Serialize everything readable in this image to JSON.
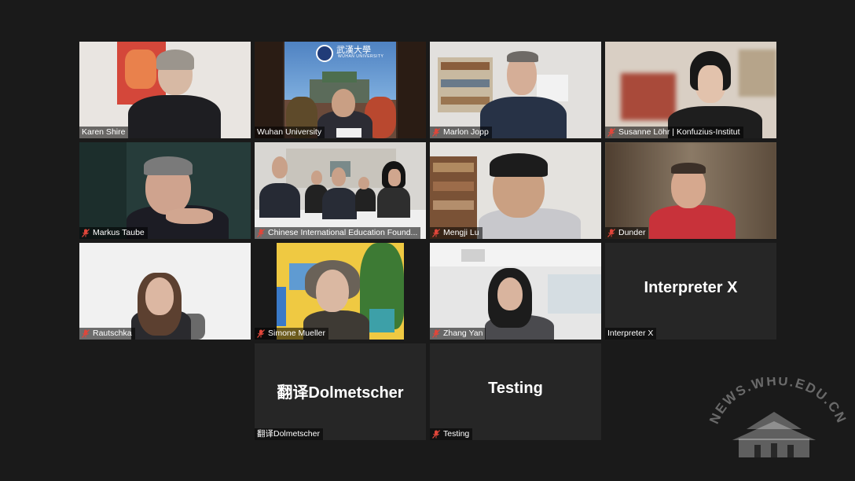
{
  "participants": [
    {
      "name": "Karen Shire",
      "muted": false
    },
    {
      "name": "Wuhan University",
      "muted": false
    },
    {
      "name": "Marlon Jopp",
      "muted": true
    },
    {
      "name": "Susanne Löhr | Konfuzius-Institut",
      "muted": true
    },
    {
      "name": "Markus Taube",
      "muted": true
    },
    {
      "name": "Chinese International Education Found...",
      "muted": true
    },
    {
      "name": "Mengji Lu",
      "muted": true
    },
    {
      "name": "Dunder",
      "muted": true
    },
    {
      "name": "Rautschka",
      "muted": true
    },
    {
      "name": "Simone Mueller",
      "muted": true
    },
    {
      "name": "Zhang Yan",
      "muted": true
    },
    {
      "name": "Interpreter X",
      "muted": false,
      "display_text": "Interpreter X"
    },
    {
      "name": "翻译Dolmetscher",
      "muted": false,
      "display_text": "翻译Dolmetscher"
    },
    {
      "name": "Testing",
      "muted": true,
      "display_text": "Testing"
    }
  ],
  "wuhan_banner": {
    "title": "武漢大學",
    "subtitle": "WUHAN UNIVERSITY"
  },
  "watermark": "NEWS.WHU.EDU.CN",
  "colors": {
    "background": "#1a1a1a",
    "active_speaker_border": "#c7e25a",
    "mute_icon": "#e0463a"
  }
}
